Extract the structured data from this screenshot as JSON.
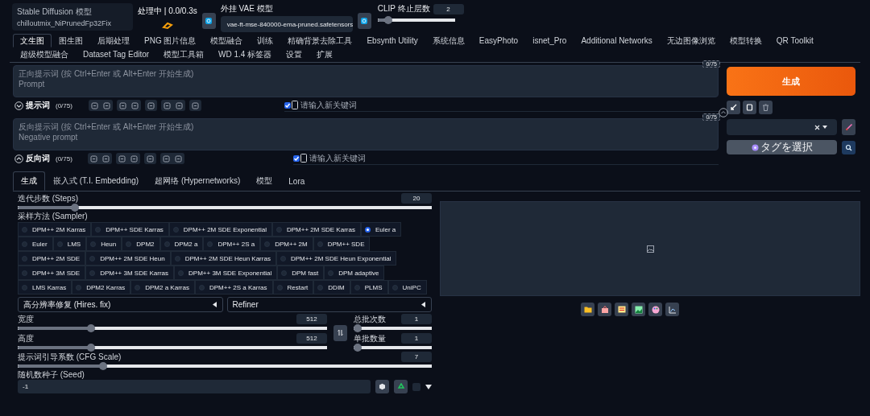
{
  "header": {
    "model_label": "Stable Diffusion 模型",
    "model_value": "chilloutmix_NiPrunedFp32Fix",
    "model_disabled": true,
    "status": "处理中 | 0.0/0.3s",
    "vae_label": "外挂 VAE 模型",
    "vae_value": "vae-ft-mse-840000-ema-pruned.safetensors",
    "clip": {
      "label": "CLIP 终止层数",
      "value": "2",
      "level": 0.1
    }
  },
  "tabs": [
    {
      "label": "文生图",
      "selected": true
    },
    {
      "label": "图生图",
      "selected": false
    },
    {
      "label": "后期处理",
      "selected": false
    },
    {
      "label": "PNG 图片信息",
      "selected": false
    },
    {
      "label": "模型融合",
      "selected": false
    },
    {
      "label": "训练",
      "selected": false
    },
    {
      "label": "精确背景去除工具",
      "selected": false
    },
    {
      "label": "Ebsynth Utility",
      "selected": false
    },
    {
      "label": "系统信息",
      "selected": false
    },
    {
      "label": "EasyPhoto",
      "selected": false
    },
    {
      "label": "isnet_Pro",
      "selected": false
    },
    {
      "label": "Additional Networks",
      "selected": false
    },
    {
      "label": "无边图像浏览",
      "selected": false
    },
    {
      "label": "模型转换",
      "selected": false
    },
    {
      "label": "QR Toolkit",
      "selected": false
    },
    {
      "label": "超级模型融合",
      "selected": false
    },
    {
      "label": "Dataset Tag Editor",
      "selected": false
    },
    {
      "label": "模型工具箱",
      "selected": false
    },
    {
      "label": "WD 1.4 标签器",
      "selected": false
    },
    {
      "label": "设置",
      "selected": false
    },
    {
      "label": "扩展",
      "selected": false
    }
  ],
  "prompts": [
    {
      "placeholder": "正向提示词 (按 Ctrl+Enter 或 Alt+Enter 开始生成)\nPrompt",
      "counter": "0/75",
      "title": "提示词",
      "count": "(0/75)",
      "expanded": true,
      "keyword_checked": true,
      "keyword_placeholder": "请输入新关键词"
    },
    {
      "placeholder": "反向提示词 (按 Ctrl+Enter 或 Alt+Enter 开始生成)\nNegative prompt",
      "counter": "0/75",
      "title": "反向词",
      "count": "(0/75)",
      "expanded": false,
      "keyword_checked": true,
      "keyword_placeholder": "请输入新关键词"
    }
  ],
  "actions": {
    "generate": "生成",
    "tag_select": "タグを選択"
  },
  "subtabs": [
    {
      "label": "生成",
      "selected": true
    },
    {
      "label": "嵌入式 (T.I. Embedding)",
      "selected": false
    },
    {
      "label": "超网络 (Hypernetworks)",
      "selected": false
    },
    {
      "label": "模型",
      "selected": false
    },
    {
      "label": "Lora",
      "selected": false
    }
  ],
  "steps": {
    "label": "迭代步数 (Steps)",
    "value": "20",
    "level": 0.13
  },
  "sampler": {
    "label": "采样方法 (Sampler)",
    "options": [
      {
        "label": "DPM++ 2M Karras",
        "selected": false
      },
      {
        "label": "DPM++ SDE Karras",
        "selected": false
      },
      {
        "label": "DPM++ 2M SDE Exponential",
        "selected": false
      },
      {
        "label": "DPM++ 2M SDE Karras",
        "selected": false
      },
      {
        "label": "Euler a",
        "selected": true
      },
      {
        "label": "Euler",
        "selected": false
      },
      {
        "label": "LMS",
        "selected": false
      },
      {
        "label": "Heun",
        "selected": false
      },
      {
        "label": "DPM2",
        "selected": false
      },
      {
        "label": "DPM2 a",
        "selected": false
      },
      {
        "label": "DPM++ 2S a",
        "selected": false
      },
      {
        "label": "DPM++ 2M",
        "selected": false
      },
      {
        "label": "DPM++ SDE",
        "selected": false
      },
      {
        "label": "DPM++ 2M SDE",
        "selected": false
      },
      {
        "label": "DPM++ 2M SDE Heun",
        "selected": false
      },
      {
        "label": "DPM++ 2M SDE Heun Karras",
        "selected": false
      },
      {
        "label": "DPM++ 2M SDE Heun Exponential",
        "selected": false
      },
      {
        "label": "DPM++ 3M SDE",
        "selected": false
      },
      {
        "label": "DPM++ 3M SDE Karras",
        "selected": false
      },
      {
        "label": "DPM++ 3M SDE Exponential",
        "selected": false
      },
      {
        "label": "DPM fast",
        "selected": false
      },
      {
        "label": "DPM adaptive",
        "selected": false
      },
      {
        "label": "LMS Karras",
        "selected": false
      },
      {
        "label": "DPM2 Karras",
        "selected": false
      },
      {
        "label": "DPM2 a Karras",
        "selected": false
      },
      {
        "label": "DPM++ 2S a Karras",
        "selected": false
      },
      {
        "label": "Restart",
        "selected": false
      },
      {
        "label": "DDIM",
        "selected": false
      },
      {
        "label": "PLMS",
        "selected": false
      },
      {
        "label": "UniPC",
        "selected": false
      }
    ]
  },
  "accordions": [
    {
      "label": "高分辨率修复 (Hires. fix)",
      "expanded": false
    },
    {
      "label": "Refiner",
      "expanded": false
    }
  ],
  "width": {
    "label": "宽度",
    "value": "512",
    "level": 0.23
  },
  "height": {
    "label": "高度",
    "value": "512",
    "level": 0.23
  },
  "batch_count": {
    "label": "总批次数",
    "value": "1",
    "level": 0
  },
  "batch_size": {
    "label": "单批数量",
    "value": "1",
    "level": 0
  },
  "cfg": {
    "label": "提示词引导系数 (CFG Scale)",
    "value": "7",
    "level": 0.2
  },
  "seed": {
    "label": "随机数种子 (Seed)",
    "value": "-1",
    "extra_checked": false
  }
}
